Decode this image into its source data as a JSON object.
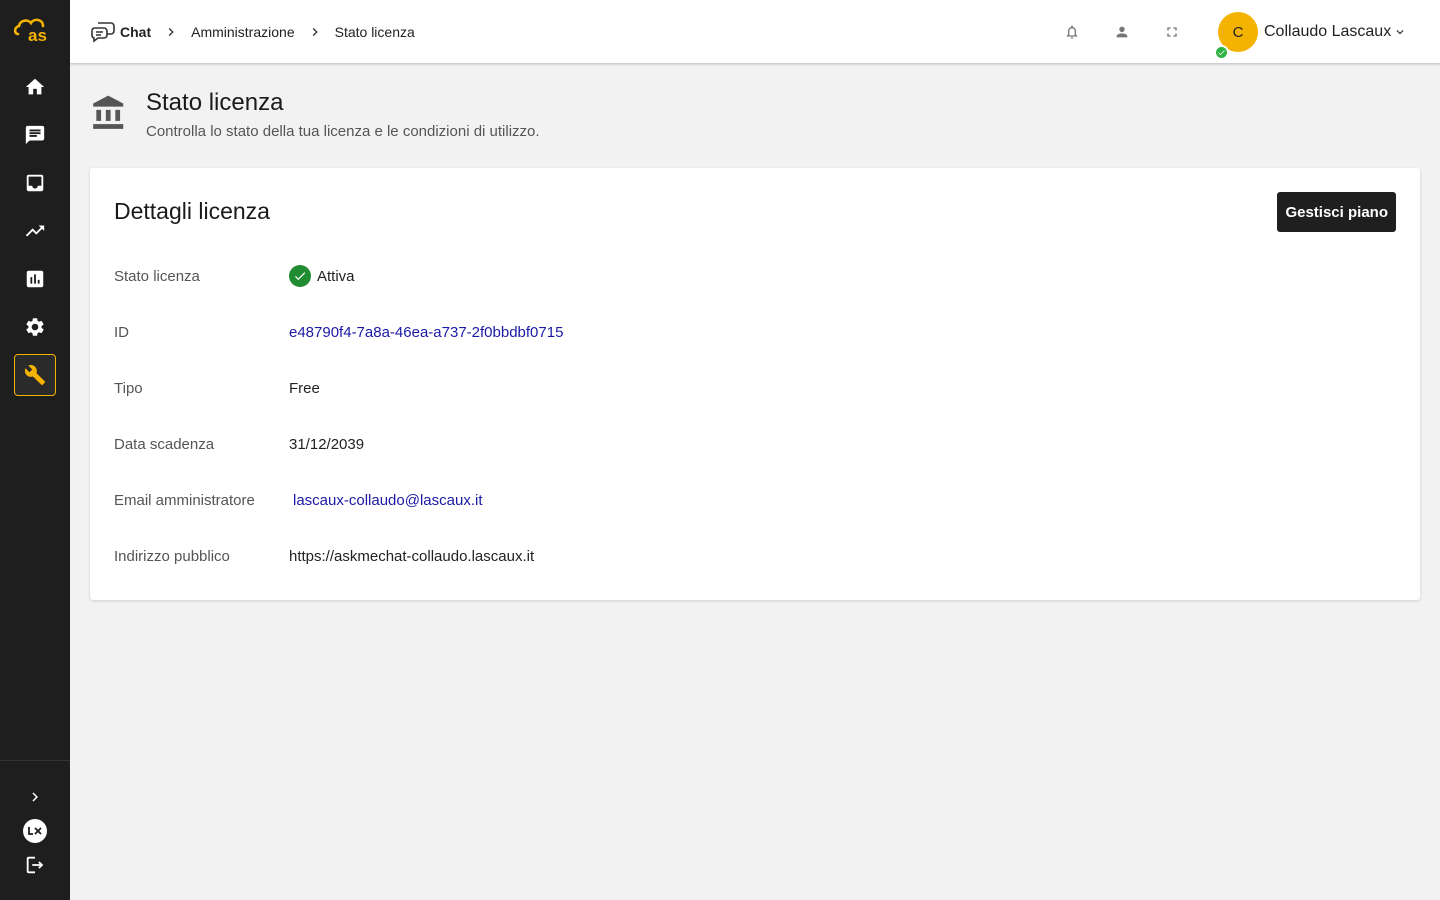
{
  "colors": {
    "sidebar": "#1e1e1e",
    "accent": "#f5b301",
    "link": "#1a1aa6",
    "success": "#218c32"
  },
  "sidebar": {
    "logo_text": "as",
    "items": [
      {
        "name": "home",
        "icon": "home-icon"
      },
      {
        "name": "chat",
        "icon": "chat-icon"
      },
      {
        "name": "inbox",
        "icon": "inbox-icon"
      },
      {
        "name": "trending",
        "icon": "trending-up-icon"
      },
      {
        "name": "analytics",
        "icon": "bar-chart-icon"
      },
      {
        "name": "settings",
        "icon": "gear-icon"
      },
      {
        "name": "administration",
        "icon": "wrench-icon",
        "active": true
      }
    ],
    "bottom": [
      {
        "name": "expand",
        "icon": "chevron-right-icon"
      },
      {
        "name": "brand",
        "icon": "lascaux-logo-icon"
      },
      {
        "name": "logout",
        "icon": "logout-icon"
      }
    ]
  },
  "breadcrumb": {
    "chat": "Chat",
    "admin": "Amministrazione",
    "current": "Stato licenza"
  },
  "user": {
    "initial": "C",
    "name": "Collaudo Lascaux"
  },
  "page": {
    "title": "Stato licenza",
    "subtitle": "Controlla lo stato della tua licenza e le condizioni di utilizzo."
  },
  "card": {
    "title": "Dettagli licenza",
    "button": "Gestisci piano",
    "rows": [
      {
        "label": "Stato licenza",
        "value": "Attiva"
      },
      {
        "label": "ID",
        "value": "e48790f4-7a8a-46ea-a737-2f0bbdbf0715"
      },
      {
        "label": "Tipo",
        "value": "Free"
      },
      {
        "label": "Data scadenza",
        "value": "31/12/2039"
      },
      {
        "label": "Email amministratore",
        "value": "lascaux-collaudo@lascaux.it"
      },
      {
        "label": "Indirizzo pubblico",
        "value": "https://askmechat-collaudo.lascaux.it"
      }
    ]
  }
}
